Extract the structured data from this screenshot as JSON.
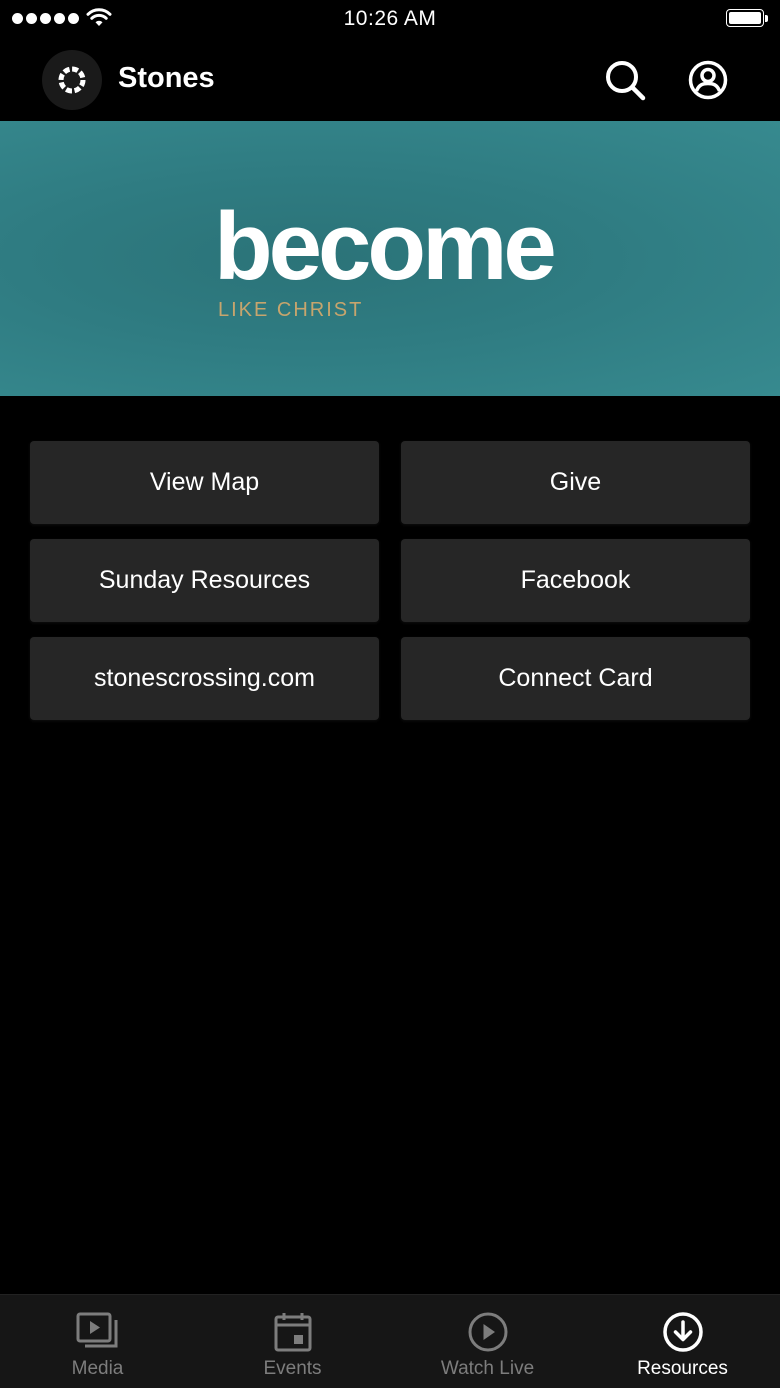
{
  "status_bar": {
    "time": "10:26 AM"
  },
  "header": {
    "title": "Stones",
    "logo_icon": "church-ring-logo-icon",
    "search_icon": "search-icon",
    "account_icon": "account-circle-icon"
  },
  "banner": {
    "title": "become",
    "subtitle": "LIKE CHRIST",
    "background_color": "#2f7c82",
    "subtitle_color": "#c7a56d"
  },
  "resources": {
    "buttons": [
      {
        "label": "View Map"
      },
      {
        "label": "Give"
      },
      {
        "label": "Sunday Resources"
      },
      {
        "label": "Facebook"
      },
      {
        "label": "stonescrossing.com"
      },
      {
        "label": "Connect Card"
      }
    ],
    "button_color": "#262626"
  },
  "tabbar": {
    "tabs": [
      {
        "label": "Media",
        "icon": "media-play-icon",
        "active": false
      },
      {
        "label": "Events",
        "icon": "calendar-icon",
        "active": false
      },
      {
        "label": "Watch Live",
        "icon": "play-circle-icon",
        "active": false
      },
      {
        "label": "Resources",
        "icon": "download-circle-icon",
        "active": true
      }
    ],
    "active_color": "#ffffff",
    "inactive_color": "#7d7d7d"
  }
}
